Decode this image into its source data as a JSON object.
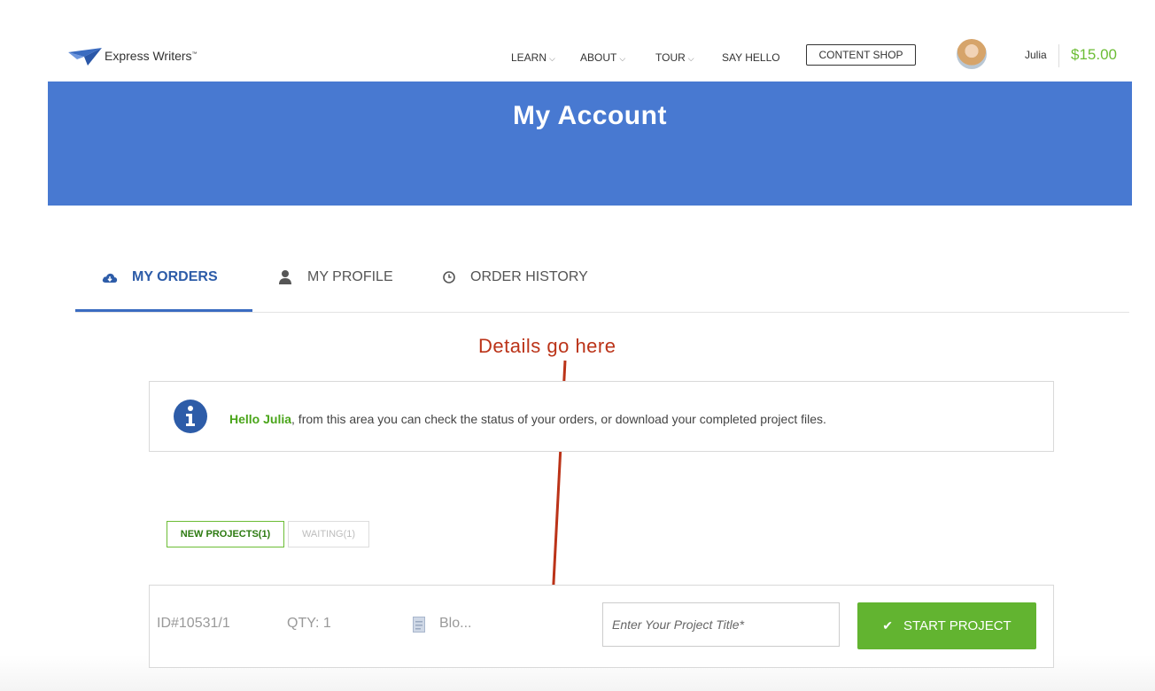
{
  "brand": {
    "name": "Express Writers",
    "mark": "™",
    "color": "#3b6cc1"
  },
  "nav": {
    "items": [
      {
        "label": "LEARN",
        "has_dropdown": true
      },
      {
        "label": "ABOUT",
        "has_dropdown": true
      },
      {
        "label": "TOUR",
        "has_dropdown": true
      },
      {
        "label": "SAY HELLO",
        "has_dropdown": false
      }
    ],
    "dropdown_glyph": "⌵",
    "shop_button": "CONTENT SHOP",
    "user": {
      "name": "Julia",
      "balance": "$15.00"
    }
  },
  "hero": {
    "title": "My Account",
    "bg_color": "#4879d1"
  },
  "tabs": [
    {
      "label": "MY ORDERS",
      "icon": "cloud-download-icon",
      "active": true
    },
    {
      "label": "MY PROFILE",
      "icon": "user-icon",
      "active": false
    },
    {
      "label": "ORDER HISTORY",
      "icon": "clock-icon",
      "active": false
    }
  ],
  "annotation": {
    "text": "Details go here",
    "color": "#bb3318"
  },
  "info": {
    "icon": "info-icon",
    "greeting": "Hello Julia",
    "message": ", from this area you can check the status of your orders, or download your completed project files."
  },
  "project_filters": {
    "new": "NEW PROJECTS(1)",
    "waiting": "WAITING(1)"
  },
  "order": {
    "id": "ID#10531/1",
    "qty": "QTY: 1",
    "name": "Blo...",
    "doc_icon": "document-icon",
    "title_placeholder": "Enter Your Project Title*",
    "start_button": "START PROJECT",
    "accent": "#62b430"
  }
}
